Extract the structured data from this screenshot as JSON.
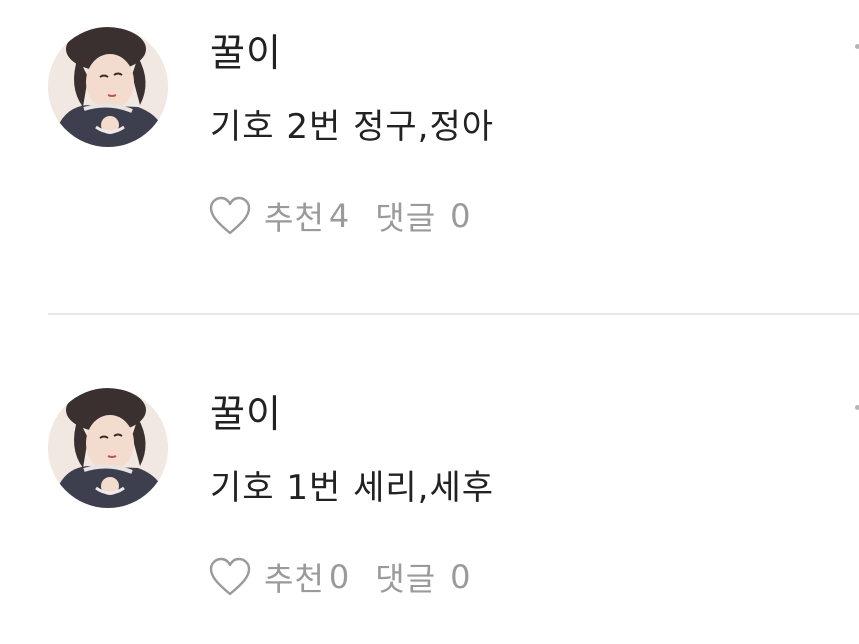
{
  "comments": [
    {
      "author": "꿀이",
      "text": "기호 2번 정구,정아",
      "recommend_label": "추천",
      "recommend_count": "4",
      "reply_label": "댓글",
      "reply_count": "0"
    },
    {
      "author": "꿀이",
      "text": "기호 1번 세리,세후",
      "recommend_label": "추천",
      "recommend_count": "0",
      "reply_label": "댓글",
      "reply_count": "0"
    }
  ],
  "icons": {
    "heart": "heart-outline-icon",
    "more": "more-dot-icon"
  },
  "colors": {
    "text": "#222222",
    "muted": "#9a9a9a",
    "divider": "#e6e6e6"
  }
}
